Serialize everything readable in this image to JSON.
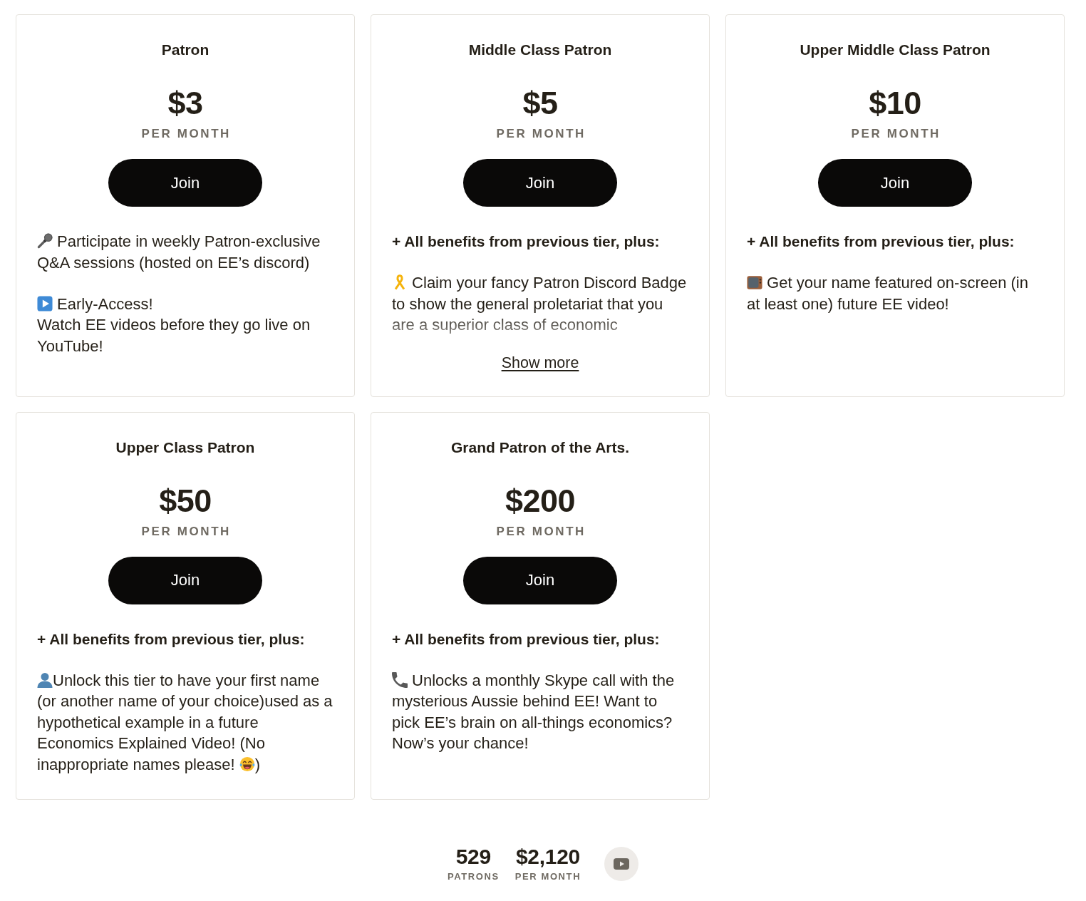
{
  "tiers": [
    {
      "title": "Patron",
      "price": "$3",
      "period": "PER MONTH",
      "button": "Join",
      "description": {
        "paragraphs": [
          {
            "kind": "text",
            "parts": [
              {
                "kind": "icon"
              },
              {
                "kind": "text",
                "text": " Participate in weekly Patron-exclusive Q&A sessions (hosted on EE’s discord)"
              }
            ]
          },
          {
            "kind": "text",
            "parts": [
              {
                "kind": "icon"
              },
              {
                "kind": "text",
                "text": " Early-Access!\nWatch EE videos before they go live on YouTube!"
              }
            ]
          }
        ]
      }
    },
    {
      "title": "Middle Class Patron",
      "price": "$5",
      "period": "PER MONTH",
      "button": "Join",
      "description": {
        "expanded": false,
        "toggle": "Show more",
        "paragraphs": [
          {
            "kind": "lead",
            "parts": [
              {
                "kind": "text",
                "text": "+ All benefits from previous tier, plus:"
              }
            ]
          },
          {
            "kind": "text",
            "parts": [
              {
                "kind": "icon"
              },
              {
                "kind": "text",
                "text": " Claim your fancy Patron Discord Badge to show the general proletariat that you are a superior class of economic"
              }
            ]
          }
        ]
      }
    },
    {
      "title": "Upper Middle Class Patron",
      "price": "$10",
      "period": "PER MONTH",
      "button": "Join",
      "description": {
        "paragraphs": [
          {
            "kind": "lead",
            "parts": [
              {
                "kind": "text",
                "text": "+ All benefits from previous tier, plus:"
              }
            ]
          },
          {
            "kind": "text",
            "parts": [
              {
                "kind": "icon"
              },
              {
                "kind": "text",
                "text": " Get your name featured on-screen (in at least one) future EE video!"
              }
            ]
          }
        ]
      }
    },
    {
      "title": "Upper Class Patron",
      "price": "$50",
      "period": "PER MONTH",
      "button": "Join",
      "description": {
        "paragraphs": [
          {
            "kind": "lead",
            "parts": [
              {
                "kind": "text",
                "text": "+ All benefits from previous tier, plus:"
              }
            ]
          },
          {
            "kind": "text",
            "parts": [
              {
                "kind": "icon"
              },
              {
                "kind": "text",
                "text": "Unlock this tier to have your first name (or another name of your choice)used as a hypothetical example in a future Economics Explained Video! (No inappropriate names please! "
              },
              {
                "kind": "icon"
              },
              {
                "kind": "text",
                "text": ")"
              }
            ]
          }
        ]
      }
    },
    {
      "title": "Grand Patron of the Arts.",
      "price": "$200",
      "period": "PER MONTH",
      "button": "Join",
      "description": {
        "paragraphs": [
          {
            "kind": "lead",
            "parts": [
              {
                "kind": "text",
                "text": "+ All benefits from previous tier, plus:"
              }
            ]
          },
          {
            "kind": "text",
            "parts": [
              {
                "kind": "icon"
              },
              {
                "kind": "text",
                "text": " Unlocks a monthly Skype call with the mysterious Aussie behind EE! Want to pick EE’s brain on all-things economics? Now’s your chance!"
              }
            ]
          }
        ]
      }
    }
  ],
  "stats": [
    {
      "value": "529",
      "label": "PATRONS"
    },
    {
      "value": "$2,120",
      "label": "PER MONTH"
    }
  ]
}
